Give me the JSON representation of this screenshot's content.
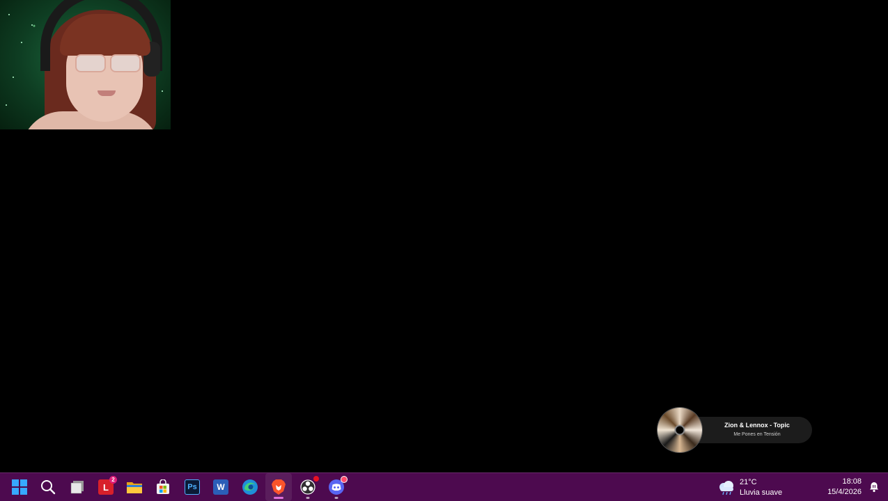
{
  "now_playing": {
    "artist": "Zion & Lennox - Topic",
    "title": "Me Pones en Tensión"
  },
  "taskbar": {
    "apps": [
      {
        "name": "start",
        "icon": "windows-logo-icon"
      },
      {
        "name": "search",
        "icon": "search-icon"
      },
      {
        "name": "task-view",
        "icon": "task-view-icon"
      },
      {
        "name": "l-app",
        "icon": "red-l-app-icon",
        "label": "L",
        "badge": "2"
      },
      {
        "name": "file-explorer",
        "icon": "folder-icon"
      },
      {
        "name": "microsoft-store",
        "icon": "store-icon"
      },
      {
        "name": "photoshop",
        "icon": "photoshop-icon",
        "label": "Ps"
      },
      {
        "name": "word",
        "icon": "word-icon",
        "label": "W"
      },
      {
        "name": "edge",
        "icon": "edge-icon"
      },
      {
        "name": "brave",
        "icon": "brave-icon"
      },
      {
        "name": "obs",
        "icon": "obs-icon"
      },
      {
        "name": "discord",
        "icon": "discord-icon"
      }
    ],
    "weather": {
      "temperature": "21°C",
      "condition": "Lluvia suave"
    },
    "clock": {
      "time": "18:08",
      "date": "15/4/2026"
    }
  },
  "colors": {
    "taskbar_bg": "#4d0a4f",
    "desktop_bg": "#000000",
    "accent": "#37a8ff",
    "active_indicator": "#e070d8"
  }
}
